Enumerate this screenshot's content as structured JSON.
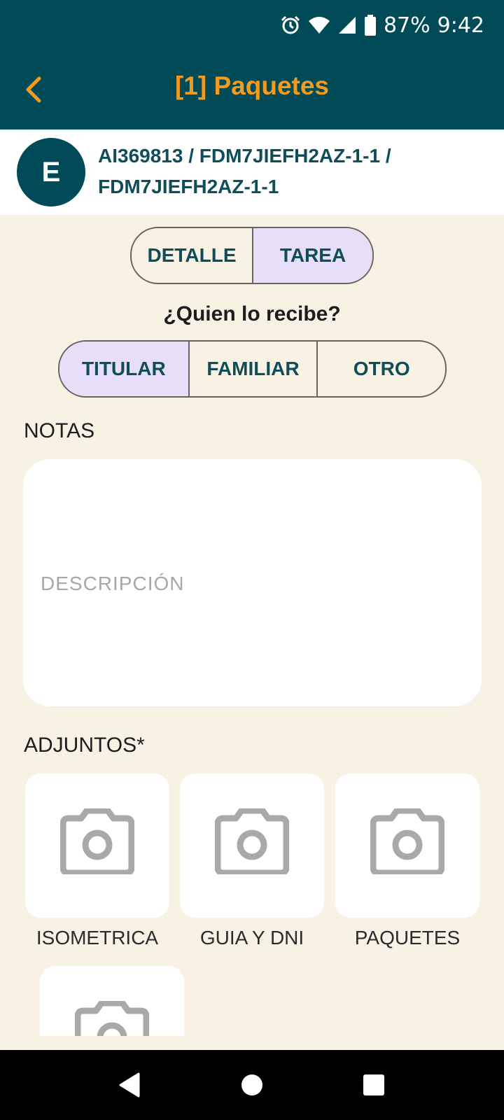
{
  "status_bar": {
    "battery": "87%",
    "time": "9:42",
    "icons": [
      "alarm-icon",
      "wifi-icon",
      "signal-icon",
      "battery-icon"
    ]
  },
  "app_bar": {
    "title": "[1] Paquetes",
    "back_icon": "chevron-left-icon"
  },
  "order": {
    "avatar_letter": "E",
    "reference_line1": "AI369813 / FDM7JIEFH2AZ-1-1 /",
    "reference_line2": "FDM7JIEFH2AZ-1-1"
  },
  "view_tabs": {
    "options": [
      "DETALLE",
      "TAREA"
    ],
    "selected": "TAREA"
  },
  "recipient": {
    "question": "¿Quien lo recibe?",
    "options": [
      "TITULAR",
      "FAMILIAR",
      "OTRO"
    ],
    "selected": "TITULAR"
  },
  "notes": {
    "label": "NOTAS",
    "placeholder": "DESCRIPCIÓN",
    "value": ""
  },
  "attachments": {
    "label": "ADJUNTOS*",
    "items": [
      {
        "label": "ISOMETRICA",
        "icon": "camera-icon"
      },
      {
        "label": "GUIA Y DNI",
        "icon": "camera-icon"
      },
      {
        "label": "PAQUETES",
        "icon": "camera-icon"
      },
      {
        "label": "",
        "icon": "camera-icon"
      }
    ]
  },
  "colors": {
    "primary": "#004b57",
    "accent": "#f39a1f",
    "background": "#f8f2e5",
    "selected_segment": "#e6dff7",
    "text_teal": "#0f4d5a",
    "icon_gray": "#a9a9a9"
  }
}
